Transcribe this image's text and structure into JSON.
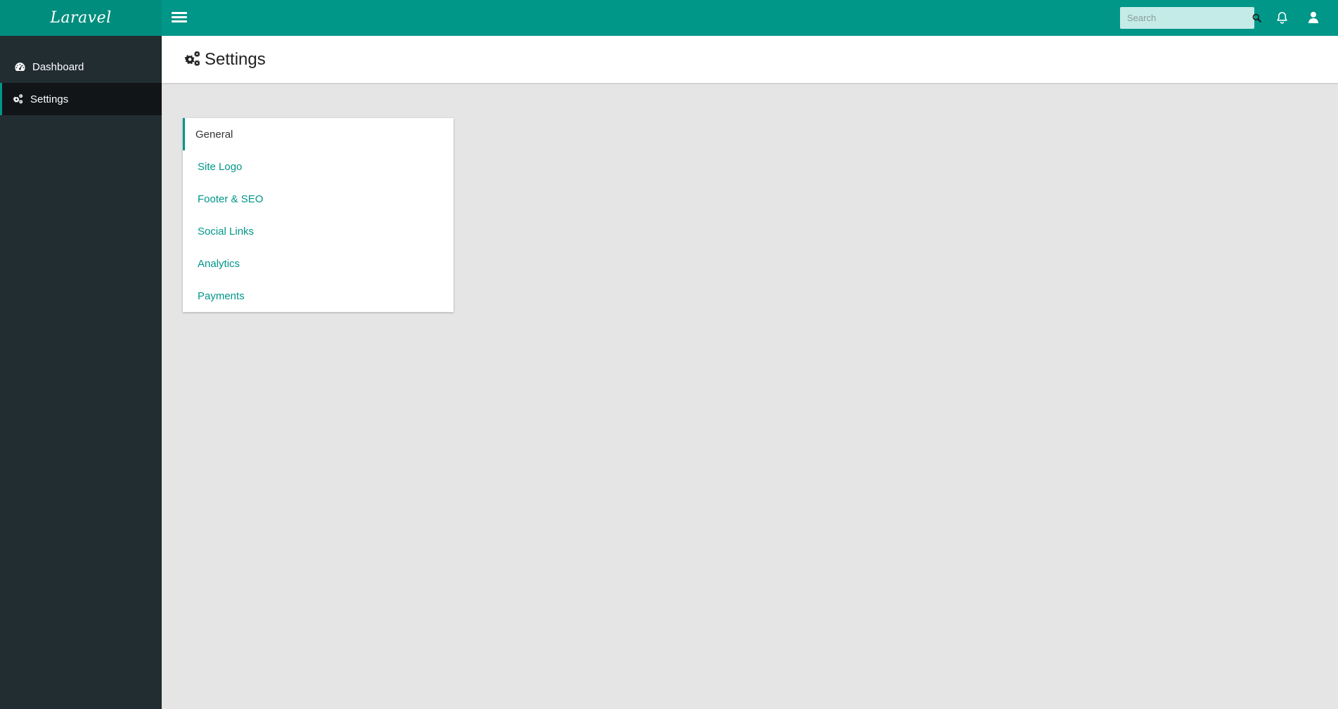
{
  "brand": {
    "name": "Laravel"
  },
  "colors": {
    "accent": "#009688",
    "brand_bg": "#008d7e",
    "sidebar_bg": "#222d32",
    "sidebar_active_bg": "#111517",
    "content_bg": "#e5e5e5"
  },
  "sidebar": {
    "items": [
      {
        "label": "Dashboard",
        "icon": "dashboard-icon",
        "active": false
      },
      {
        "label": "Settings",
        "icon": "gears-icon",
        "active": true
      }
    ]
  },
  "topbar": {
    "menu_icon": "hamburger-icon",
    "search": {
      "placeholder": "Search",
      "value": "",
      "icon": "search-icon"
    },
    "notifications_icon": "bell-icon",
    "user_icon": "user-icon"
  },
  "page": {
    "title": "Settings",
    "icon": "gears-icon"
  },
  "settings_menu": {
    "items": [
      {
        "label": "General",
        "active": true
      },
      {
        "label": "Site Logo",
        "active": false
      },
      {
        "label": "Footer & SEO",
        "active": false
      },
      {
        "label": "Social Links",
        "active": false
      },
      {
        "label": "Analytics",
        "active": false
      },
      {
        "label": "Payments",
        "active": false
      }
    ]
  }
}
